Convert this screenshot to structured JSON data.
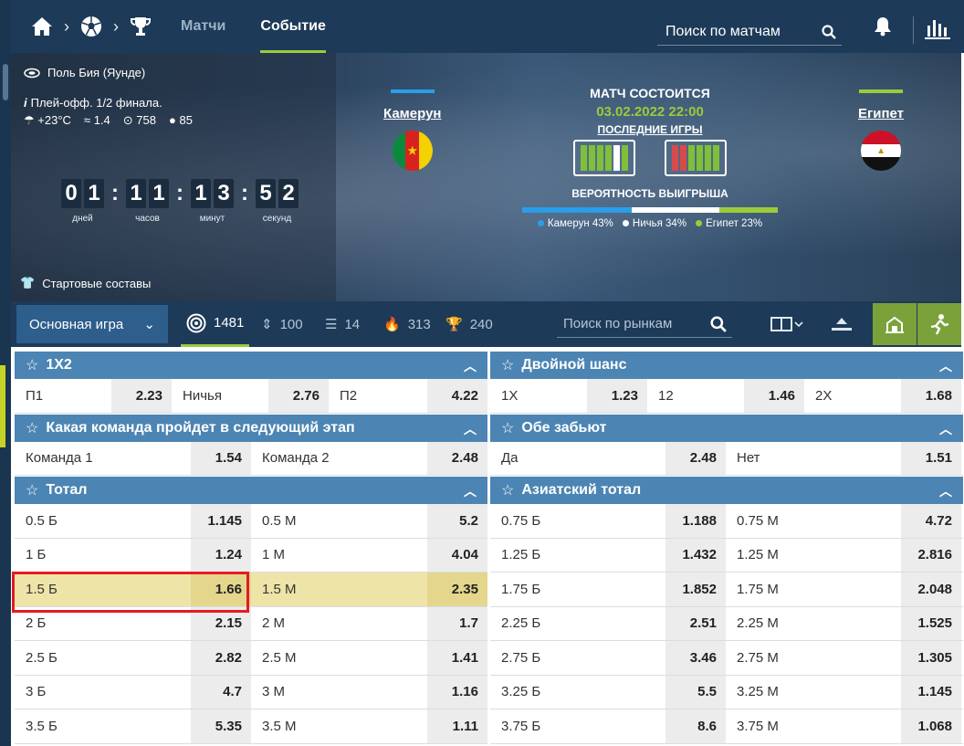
{
  "nav": {
    "matches": "Матчи",
    "event": "Событие",
    "search_placeholder": "Поиск по матчам"
  },
  "banner": {
    "venue": "Поль Бия (Яунде)",
    "stage": "Плей-офф. 1/2 финала.",
    "temp": "+23°C",
    "wind": "1.4",
    "pressure": "758",
    "humidity": "85",
    "timer": {
      "days": [
        "0",
        "1"
      ],
      "hours": [
        "1",
        "1"
      ],
      "minutes": [
        "1",
        "3"
      ],
      "seconds": [
        "5",
        "2"
      ],
      "days_label": "дней",
      "hours_label": "часов",
      "minutes_label": "минут",
      "seconds_label": "секунд"
    },
    "lineups": "Стартовые составы",
    "home": "Камерун",
    "away": "Египет",
    "status": "МАТЧ СОСТОИТСЯ",
    "date": "03.02.2022 22:00",
    "last_games": "ПОСЛЕДНИЕ ИГРЫ",
    "prob_title": "ВЕРОЯТНОСТЬ ВЫИГРЫША",
    "prob": {
      "home": 43,
      "draw": 34,
      "away": 23
    },
    "legend_home": "Камерун 43%",
    "legend_draw": "Ничья 34%",
    "legend_away": "Египет 23%"
  },
  "marketbar": {
    "select": "Основная игра",
    "all": "1481",
    "c2": "100",
    "c3": "14",
    "c4": "313",
    "c5": "240",
    "search_placeholder": "Поиск по рынкам"
  },
  "markets": {
    "m1x2": {
      "title": "1X2",
      "p1": "П1",
      "p1o": "2.23",
      "x": "Ничья",
      "xo": "2.76",
      "p2": "П2",
      "p2o": "4.22"
    },
    "dc": {
      "title": "Двойной шанс",
      "a": "1X",
      "ao": "1.23",
      "b": "12",
      "bo": "1.46",
      "c": "2X",
      "co": "1.68"
    },
    "next": {
      "title": "Какая команда пройдет в следующий этап",
      "a": "Команда 1",
      "ao": "1.54",
      "b": "Команда 2",
      "bo": "2.48"
    },
    "btts": {
      "title": "Обе забьют",
      "a": "Да",
      "ao": "2.48",
      "b": "Нет",
      "bo": "1.51"
    },
    "total": {
      "title": "Тотал",
      "rows": [
        [
          "0.5 Б",
          "1.145",
          "0.5 М",
          "5.2"
        ],
        [
          "1 Б",
          "1.24",
          "1 М",
          "4.04"
        ],
        [
          "1.5 Б",
          "1.66",
          "1.5 М",
          "2.35"
        ],
        [
          "2 Б",
          "2.15",
          "2 М",
          "1.7"
        ],
        [
          "2.5 Б",
          "2.82",
          "2.5 М",
          "1.41"
        ],
        [
          "3 Б",
          "4.7",
          "3 М",
          "1.16"
        ],
        [
          "3.5 Б",
          "5.35",
          "3.5 М",
          "1.11"
        ]
      ]
    },
    "asian": {
      "title": "Азиатский тотал",
      "rows": [
        [
          "0.75 Б",
          "1.188",
          "0.75 М",
          "4.72"
        ],
        [
          "1.25 Б",
          "1.432",
          "1.25 М",
          "2.816"
        ],
        [
          "1.75 Б",
          "1.852",
          "1.75 М",
          "2.048"
        ],
        [
          "2.25 Б",
          "2.51",
          "2.25 М",
          "1.525"
        ],
        [
          "2.75 Б",
          "3.46",
          "2.75 М",
          "1.305"
        ],
        [
          "3.25 Б",
          "5.5",
          "3.25 М",
          "1.145"
        ],
        [
          "3.75 Б",
          "8.6",
          "3.75 М",
          "1.068"
        ]
      ]
    }
  }
}
